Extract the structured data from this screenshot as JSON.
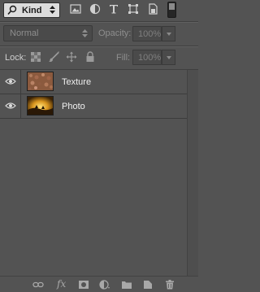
{
  "filter": {
    "kind_label": "Kind",
    "icons": [
      "image-filter-icon",
      "adjustment-filter-icon",
      "type-filter-icon",
      "shape-filter-icon",
      "smart-object-filter-icon"
    ]
  },
  "blend": {
    "mode": "Normal",
    "opacity_label": "Opacity:",
    "opacity_value": "100%"
  },
  "lock": {
    "label": "Lock:",
    "fill_label": "Fill:",
    "fill_value": "100%"
  },
  "layers": [
    {
      "name": "Texture",
      "visible": true
    },
    {
      "name": "Photo",
      "visible": true
    }
  ],
  "bottom_icons": [
    "link-layers-icon",
    "fx-icon",
    "layer-mask-icon",
    "adjustment-layer-icon",
    "new-group-icon",
    "new-layer-icon",
    "delete-layer-icon"
  ],
  "colors": {
    "panel": "#535353",
    "kind_bg": "#dcdcdc"
  }
}
